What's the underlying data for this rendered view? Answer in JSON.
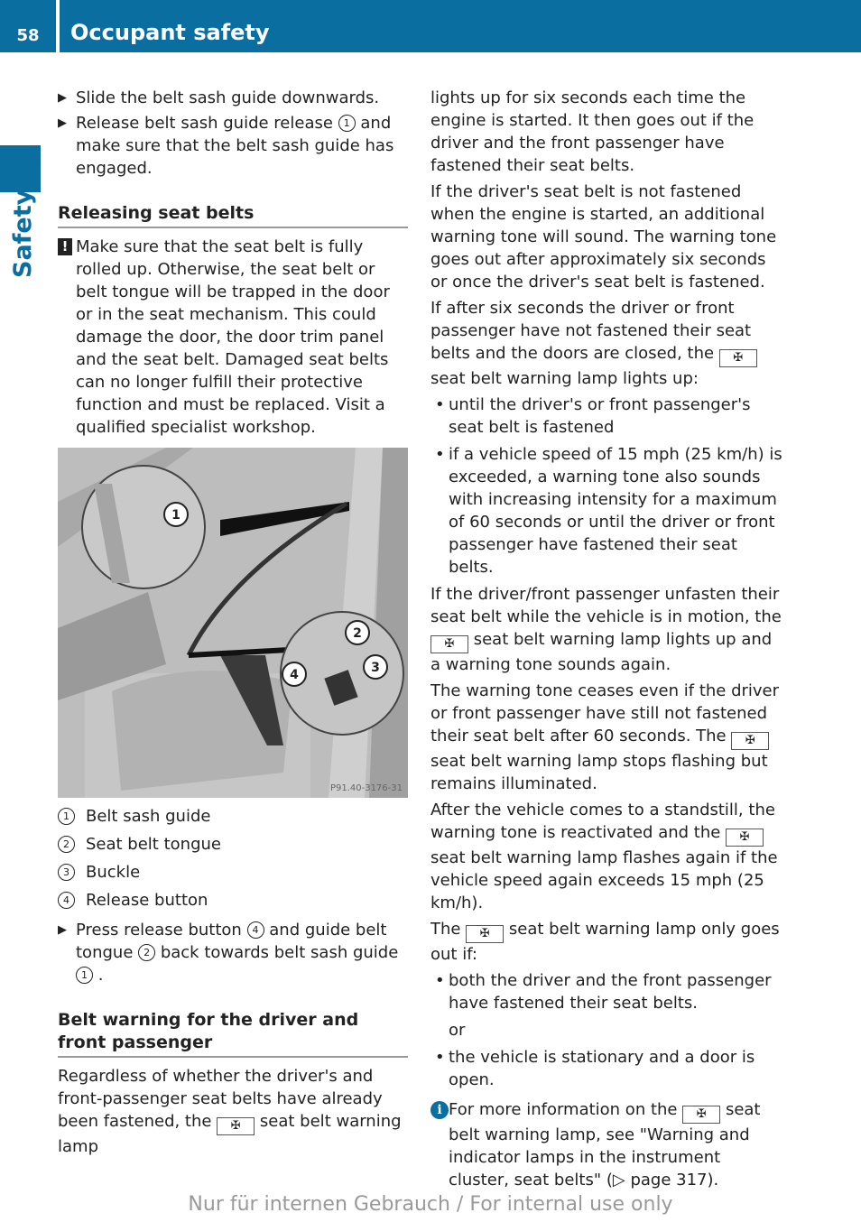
{
  "header": {
    "page_number": "58",
    "title": "Occupant safety"
  },
  "side_tab": {
    "label": "Safety"
  },
  "left_column": {
    "steps_top": [
      {
        "text": "Slide the belt sash guide downwards."
      },
      {
        "before": "Release belt sash guide release ",
        "callout": "1",
        "after": " and make sure that the belt sash guide has engaged."
      }
    ],
    "section1_heading": "Releasing seat belts",
    "warning": {
      "icon": "!",
      "text": "Make sure that the seat belt is fully rolled up. Otherwise, the seat belt or belt tongue will be trapped in the door or in the seat mechanism. This could damage the door, the door trim panel and the seat belt. Damaged seat belts can no longer fulfill their protective function and must be replaced. Visit a qualified specialist workshop."
    },
    "figure": {
      "code": "P91.40-3176-31",
      "callouts": [
        "1",
        "2",
        "3",
        "4"
      ]
    },
    "legend": [
      {
        "num": "1",
        "label": "Belt sash guide"
      },
      {
        "num": "2",
        "label": "Seat belt tongue"
      },
      {
        "num": "3",
        "label": "Buckle"
      },
      {
        "num": "4",
        "label": "Release button"
      }
    ],
    "step_bottom": {
      "p1": "Press release button ",
      "c1": "4",
      "p2": " and guide belt tongue ",
      "c2": "2",
      "p3": " back towards belt sash guide ",
      "c3": "1",
      "p4": " ."
    },
    "section2_heading": "Belt warning for the driver and front passenger",
    "intro": {
      "before": "Regardless of whether the driver's and front-passenger seat belts have already been fastened, the ",
      "after": " seat belt warning lamp"
    }
  },
  "right_column": {
    "p1": "lights up for six seconds each time the engine is started. It then goes out if the driver and the front passenger have fastened their seat belts.",
    "p2": "If the driver's seat belt is not fastened when the engine is started, an additional warning tone will sound. The warning tone goes out after approximately six seconds or once the driver's seat belt is fastened.",
    "p3": {
      "before": "If after six seconds the driver or front passenger have not fastened their seat belts and the doors are closed, the ",
      "after": " seat belt warning lamp lights up:"
    },
    "bullets1": [
      "until the driver's or front passenger's seat belt is fastened",
      "if a vehicle speed of 15 mph (25 km/h) is exceeded, a warning tone also sounds with increasing intensity for a maximum of 60 seconds or until the driver or front passenger have fastened their seat belts."
    ],
    "p4": {
      "before": "If the driver/front passenger unfasten their seat belt while the vehicle is in motion, the ",
      "after": " seat belt warning lamp lights up and a warning tone sounds again."
    },
    "p5": {
      "before": "The warning tone ceases even if the driver or front passenger have still not fastened their seat belt after 60 seconds. The ",
      "after": " seat belt warning lamp stops flashing but remains illuminated."
    },
    "p6": {
      "before": "After the vehicle comes to a standstill, the warning tone is reactivated and the ",
      "after": " seat belt warning lamp flashes again if the vehicle speed again exceeds 15 mph (25 km/h)."
    },
    "p7": {
      "before": "The ",
      "after": " seat belt warning lamp only goes out if:"
    },
    "bullets2": [
      "both the driver and the front passenger have fastened their seat belts.",
      "the vehicle is stationary and a door is open."
    ],
    "or_text": "or",
    "info": {
      "icon": "i",
      "before": "For more information on the ",
      "after": " seat belt warning lamp, see \"Warning and indicator lamps in the instrument cluster, seat belts\" (▷ page 317)."
    }
  },
  "lamp_icon": "seatbelt-icon",
  "lamp_glyph": "✠",
  "bullet_glyph": "•",
  "step_glyph": "▶",
  "footer": "Nur für internen Gebrauch / For internal use only"
}
